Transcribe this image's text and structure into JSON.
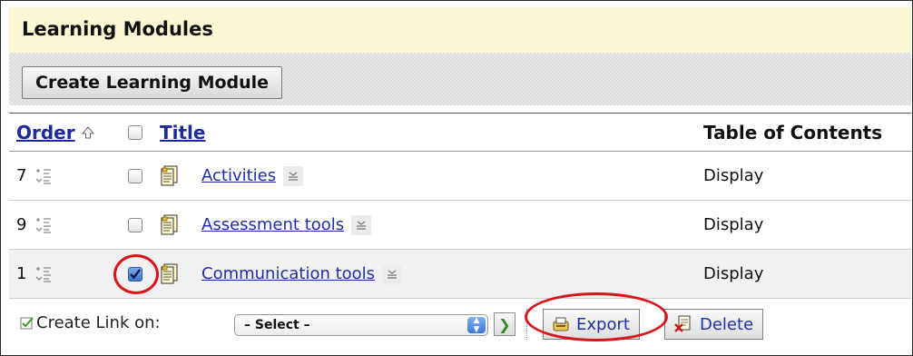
{
  "header": {
    "title": "Learning Modules"
  },
  "toolbar": {
    "create_label": "Create Learning Module"
  },
  "table": {
    "columns": {
      "order": "Order",
      "title": "Title",
      "toc": "Table of Contents"
    },
    "rows": [
      {
        "order": "7",
        "title": "Activities",
        "toc": "Display",
        "checked": false
      },
      {
        "order": "9",
        "title": "Assessment tools",
        "toc": "Display",
        "checked": false
      },
      {
        "order": "1",
        "title": "Communication tools",
        "toc": "Display",
        "checked": true
      }
    ]
  },
  "footer": {
    "create_link_label": "Create Link on:",
    "select_value": "– Select –",
    "export_label": "Export",
    "delete_label": "Delete"
  },
  "colors": {
    "title_bg": "#fbf8d3",
    "link": "#1f2ea6",
    "highlight_circle": "#d8151b"
  }
}
